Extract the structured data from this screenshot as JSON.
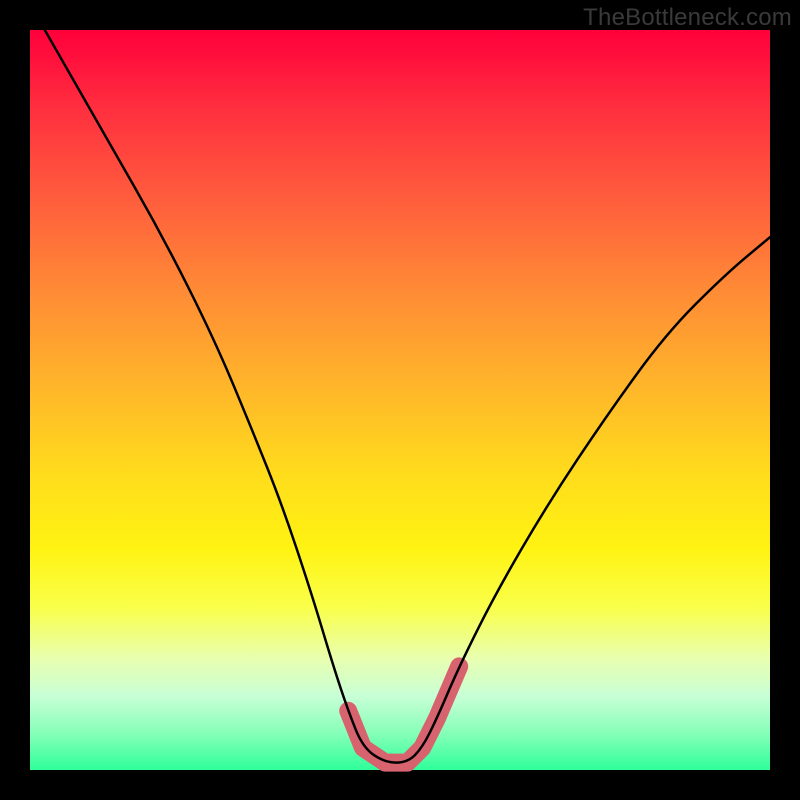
{
  "watermark": "TheBottleneck.com",
  "chart_data": {
    "type": "line",
    "title": "",
    "xlabel": "",
    "ylabel": "",
    "xlim": [
      0,
      100
    ],
    "ylim": [
      0,
      100
    ],
    "grid": false,
    "series": [
      {
        "name": "bottleneck-curve",
        "x": [
          2,
          10,
          18,
          25,
          30,
          34,
          38,
          41,
          43,
          45,
          48,
          51,
          53,
          55,
          58,
          63,
          70,
          78,
          86,
          94,
          100
        ],
        "values": [
          100,
          86,
          72,
          58,
          46,
          36,
          24,
          14,
          8,
          3,
          1,
          1,
          3,
          7,
          14,
          24,
          36,
          48,
          59,
          67,
          72
        ]
      }
    ],
    "highlight_band": {
      "x_start": 43,
      "x_end": 58,
      "color": "#d7636f"
    }
  }
}
